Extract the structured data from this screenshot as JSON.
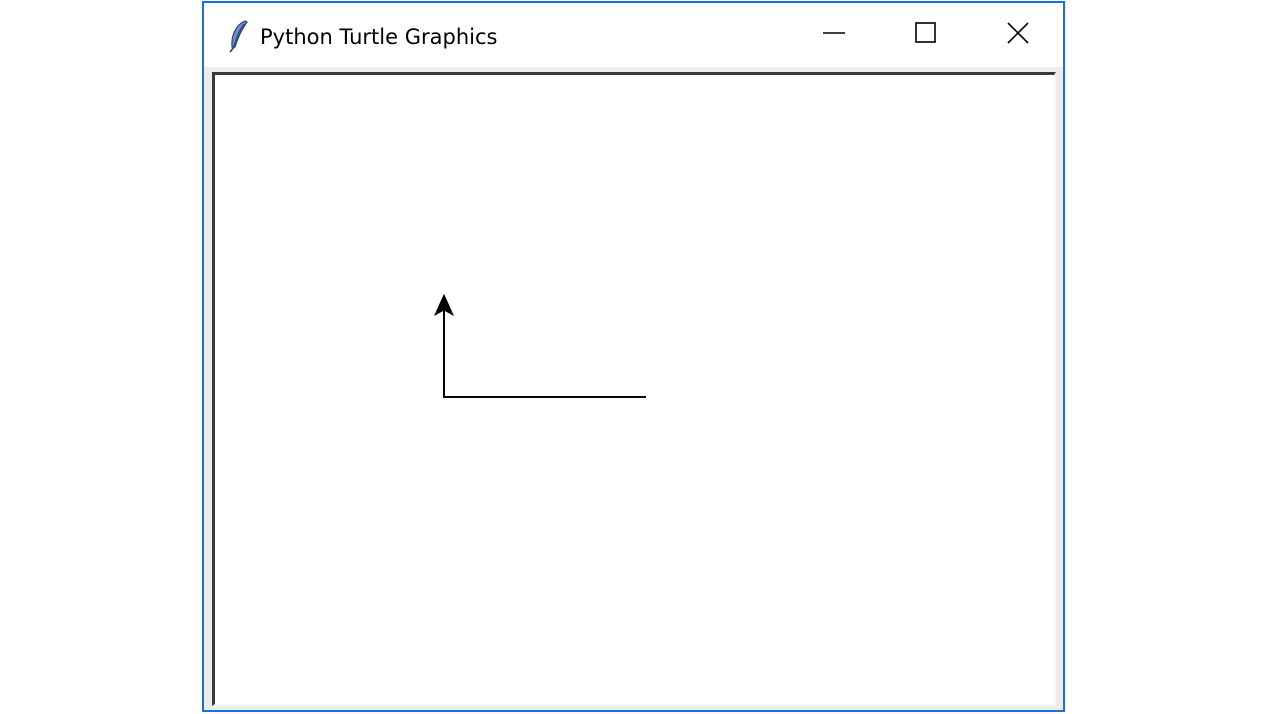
{
  "window": {
    "title": "Python Turtle Graphics",
    "app_icon": "feather-icon",
    "controls": {
      "minimize_icon": "minimize-icon",
      "maximize_icon": "maximize-icon",
      "close_icon": "close-icon"
    }
  },
  "canvas": {
    "background": "#ffffff",
    "pen_color": "#000000",
    "turtle_shape": "classic-arrow",
    "turtle_heading": "up"
  },
  "colors": {
    "window_border": "#1a73c8",
    "client_background": "#ececec"
  }
}
